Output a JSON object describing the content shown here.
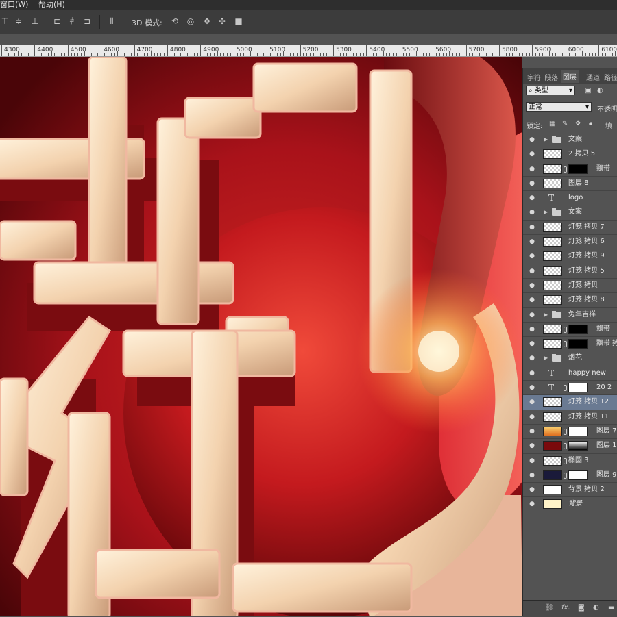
{
  "menubar": {
    "items": [
      "窗口(W)",
      "帮助(H)"
    ]
  },
  "options_bar": {
    "align_icons": [
      "align-top-edges-icon",
      "align-vertical-centers-icon",
      "align-bottom-edges-icon",
      "align-left-edges-icon",
      "align-horizontal-centers-icon",
      "align-right-edges-icon",
      "distribute-icon"
    ],
    "mode_label": "3D 模式:",
    "mode_icons": [
      "3d-rotate-icon",
      "3d-roll-icon",
      "3d-pan-icon",
      "3d-slide-icon",
      "3d-scale-icon"
    ]
  },
  "ruler": {
    "ticks": [
      "4300",
      "4400",
      "4500",
      "4600",
      "4700",
      "4800",
      "4900",
      "5000",
      "5100",
      "5200",
      "5300",
      "5400",
      "5500",
      "5600",
      "5700",
      "5800",
      "5900",
      "6000",
      "6100"
    ]
  },
  "panel": {
    "tabs": [
      "字符",
      "段落",
      "图层",
      "通道",
      "路径"
    ],
    "active_tab": "图层",
    "filter_label": "类型",
    "blend_mode": "正常",
    "opacity_label": "不透明",
    "lock_label": "锁定:",
    "fill_label": "填",
    "layers": [
      {
        "name": "文案",
        "kind": "group",
        "collapsed": true
      },
      {
        "name": "2 拷贝 5",
        "kind": "pixel"
      },
      {
        "name": "飘带",
        "kind": "pixel-mask"
      },
      {
        "name": "图层 8",
        "kind": "pixel"
      },
      {
        "name": "logo",
        "kind": "text"
      },
      {
        "name": "文案",
        "kind": "group",
        "collapsed": true
      },
      {
        "name": "灯笼 拷贝 7",
        "kind": "pixel"
      },
      {
        "name": "灯笼 拷贝 6",
        "kind": "pixel"
      },
      {
        "name": "灯笼 拷贝 9",
        "kind": "pixel"
      },
      {
        "name": "灯笼 拷贝 5",
        "kind": "pixel"
      },
      {
        "name": "灯笼 拷贝",
        "kind": "pixel"
      },
      {
        "name": "灯笼 拷贝 8",
        "kind": "pixel"
      },
      {
        "name": "兔年吉祥",
        "kind": "group",
        "collapsed": true
      },
      {
        "name": "飘带",
        "kind": "pixel-mask"
      },
      {
        "name": "飘带 拷",
        "kind": "pixel-mask"
      },
      {
        "name": "烟花",
        "kind": "group",
        "collapsed": true
      },
      {
        "name": "happy      new",
        "kind": "text"
      },
      {
        "name": "20   2",
        "kind": "text-mask"
      },
      {
        "name": "灯笼 拷贝 12",
        "kind": "pixel",
        "selected": true
      },
      {
        "name": "灯笼 拷贝 11",
        "kind": "pixel"
      },
      {
        "name": "图层 7",
        "kind": "pixel-mask"
      },
      {
        "name": "图层 1",
        "kind": "pixel-mask"
      },
      {
        "name": "椭圆 3",
        "kind": "shape"
      },
      {
        "name": "图层 9",
        "kind": "pixel-mask"
      },
      {
        "name": "背景 拷贝 2",
        "kind": "solid"
      },
      {
        "name": "背景",
        "kind": "background"
      }
    ],
    "footer_icons": [
      "link-layers-icon",
      "fx-icon",
      "add-mask-icon",
      "adjustment-layer-icon",
      "new-group-icon"
    ],
    "footer_fx": "fx."
  },
  "colors": {
    "selected_row": "#6a7a92",
    "canvas_red": "#c81818",
    "letter_cream": "#f6d9b6"
  }
}
